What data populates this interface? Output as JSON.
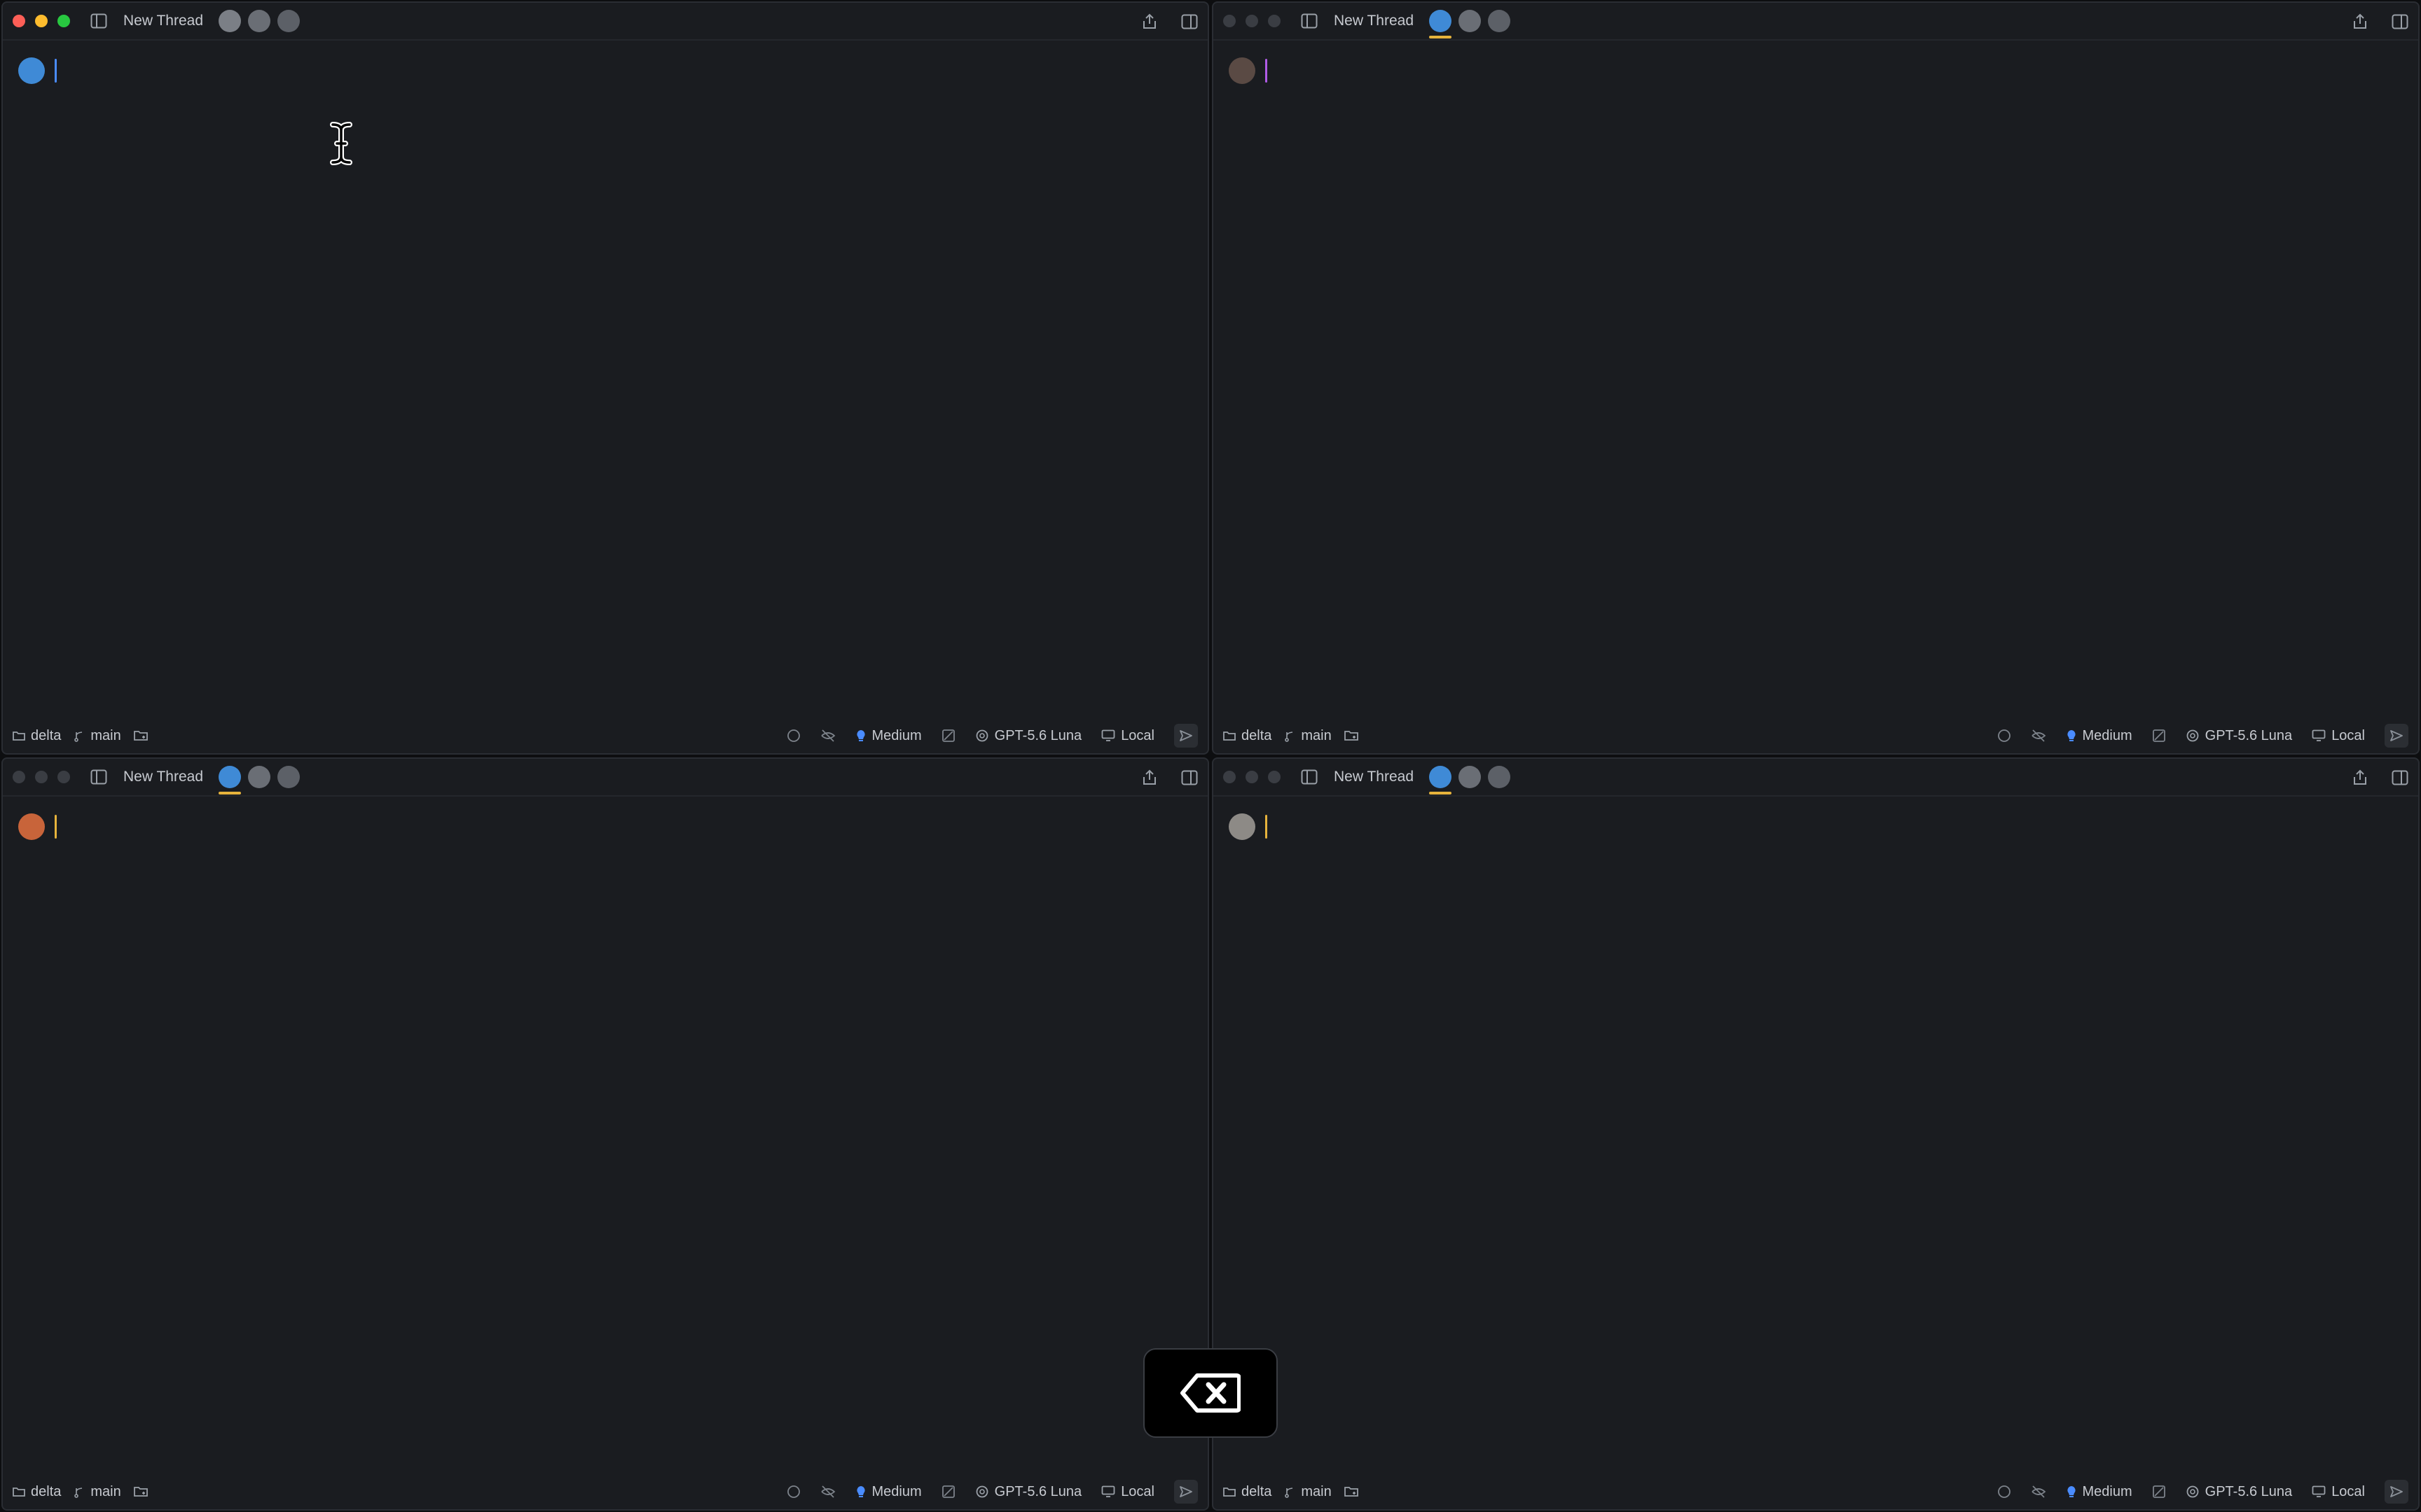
{
  "panes": [
    {
      "title": "New Thread",
      "active": true,
      "caret_color": "#4a8cff",
      "avatars": [
        "avatar-1",
        "avatar-2",
        "avatar-3"
      ],
      "footer": {
        "folder": "delta",
        "branch": "main",
        "effort": "Medium",
        "model": "GPT-5.6 Luna",
        "location": "Local"
      }
    },
    {
      "title": "New Thread",
      "active": false,
      "caret_color": "#b05be6",
      "avatars": [
        "avatar-1",
        "avatar-2",
        "avatar-3"
      ],
      "footer": {
        "folder": "delta",
        "branch": "main",
        "effort": "Medium",
        "model": "GPT-5.6 Luna",
        "location": "Local"
      }
    },
    {
      "title": "New Thread",
      "active": false,
      "caret_color": "#e6b33c",
      "avatars": [
        "avatar-1",
        "avatar-2",
        "avatar-3"
      ],
      "footer": {
        "folder": "delta",
        "branch": "main",
        "effort": "Medium",
        "model": "GPT-5.6 Luna",
        "location": "Local"
      }
    },
    {
      "title": "New Thread",
      "active": false,
      "caret_color": "#e6b33c",
      "avatars": [
        "avatar-1",
        "avatar-2",
        "avatar-3"
      ],
      "footer": {
        "folder": "delta",
        "branch": "main",
        "effort": "Medium",
        "model": "GPT-5.6 Luna",
        "location": "Local"
      }
    }
  ],
  "key_overlay": {
    "icon": "backspace-icon"
  },
  "colors": {
    "accent": "#e6b33c",
    "effort_icon": "#4a8cff"
  }
}
